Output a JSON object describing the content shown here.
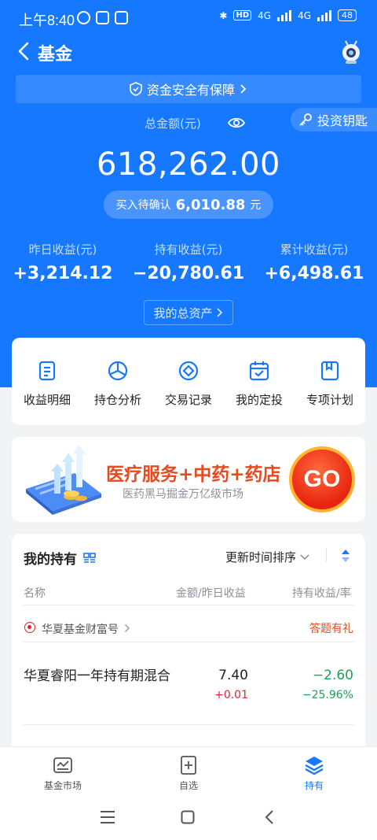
{
  "status_bar": {
    "time": "上午8:40",
    "network_1": "4G",
    "network_2": "4G",
    "hd": "HD",
    "battery": "48"
  },
  "nav": {
    "title": "基金"
  },
  "safety_banner": {
    "text": "资金安全有保障"
  },
  "key_button": {
    "label": "投资钥匙"
  },
  "summary": {
    "total_label": "总金额(元)",
    "total_value": "618,262.00",
    "pending_label": "买入待确认",
    "pending_amount": "6,010.88",
    "pending_unit": "元",
    "stats": [
      {
        "label": "昨日收益(元)",
        "value": "+3,214.12"
      },
      {
        "label": "持有收益(元)",
        "value": "−20,780.61"
      },
      {
        "label": "累计收益(元)",
        "value": "+6,498.61"
      }
    ],
    "assets_button": "我的总资产"
  },
  "quick_actions": [
    {
      "label": "收益明细",
      "icon": "document-icon"
    },
    {
      "label": "持仓分析",
      "icon": "pie-chart-icon"
    },
    {
      "label": "交易记录",
      "icon": "record-circle-icon"
    },
    {
      "label": "我的定投",
      "icon": "calendar-check-icon"
    },
    {
      "label": "专项计划",
      "icon": "bookmark-icon"
    }
  ],
  "promo": {
    "title": "医疗服务+中药+药店",
    "subtitle": "医药黑马掘金万亿级市场",
    "go_label": "GO"
  },
  "holdings": {
    "title": "我的持有",
    "sort_label": "更新时间排序",
    "columns": {
      "name": "名称",
      "amount": "金额/昨日收益",
      "return": "持有收益/率"
    },
    "group": {
      "name": "华夏基金财富号",
      "action": "答题有礼"
    },
    "funds": [
      {
        "name": "华夏睿阳一年持有期混合",
        "amount": "7.40",
        "yesterday": "+0.01",
        "hold_return": "−2.60",
        "hold_rate": "−25.96%"
      }
    ]
  },
  "tabs": [
    {
      "label": "基金市场",
      "icon": "market-icon"
    },
    {
      "label": "自选",
      "icon": "watchlist-add-icon"
    },
    {
      "label": "持有",
      "icon": "layers-icon"
    }
  ],
  "colors": {
    "primary": "#1677ff",
    "profit_red": "#e0242b",
    "loss_green": "#1aa357",
    "promo_orange": "#e8491d"
  }
}
